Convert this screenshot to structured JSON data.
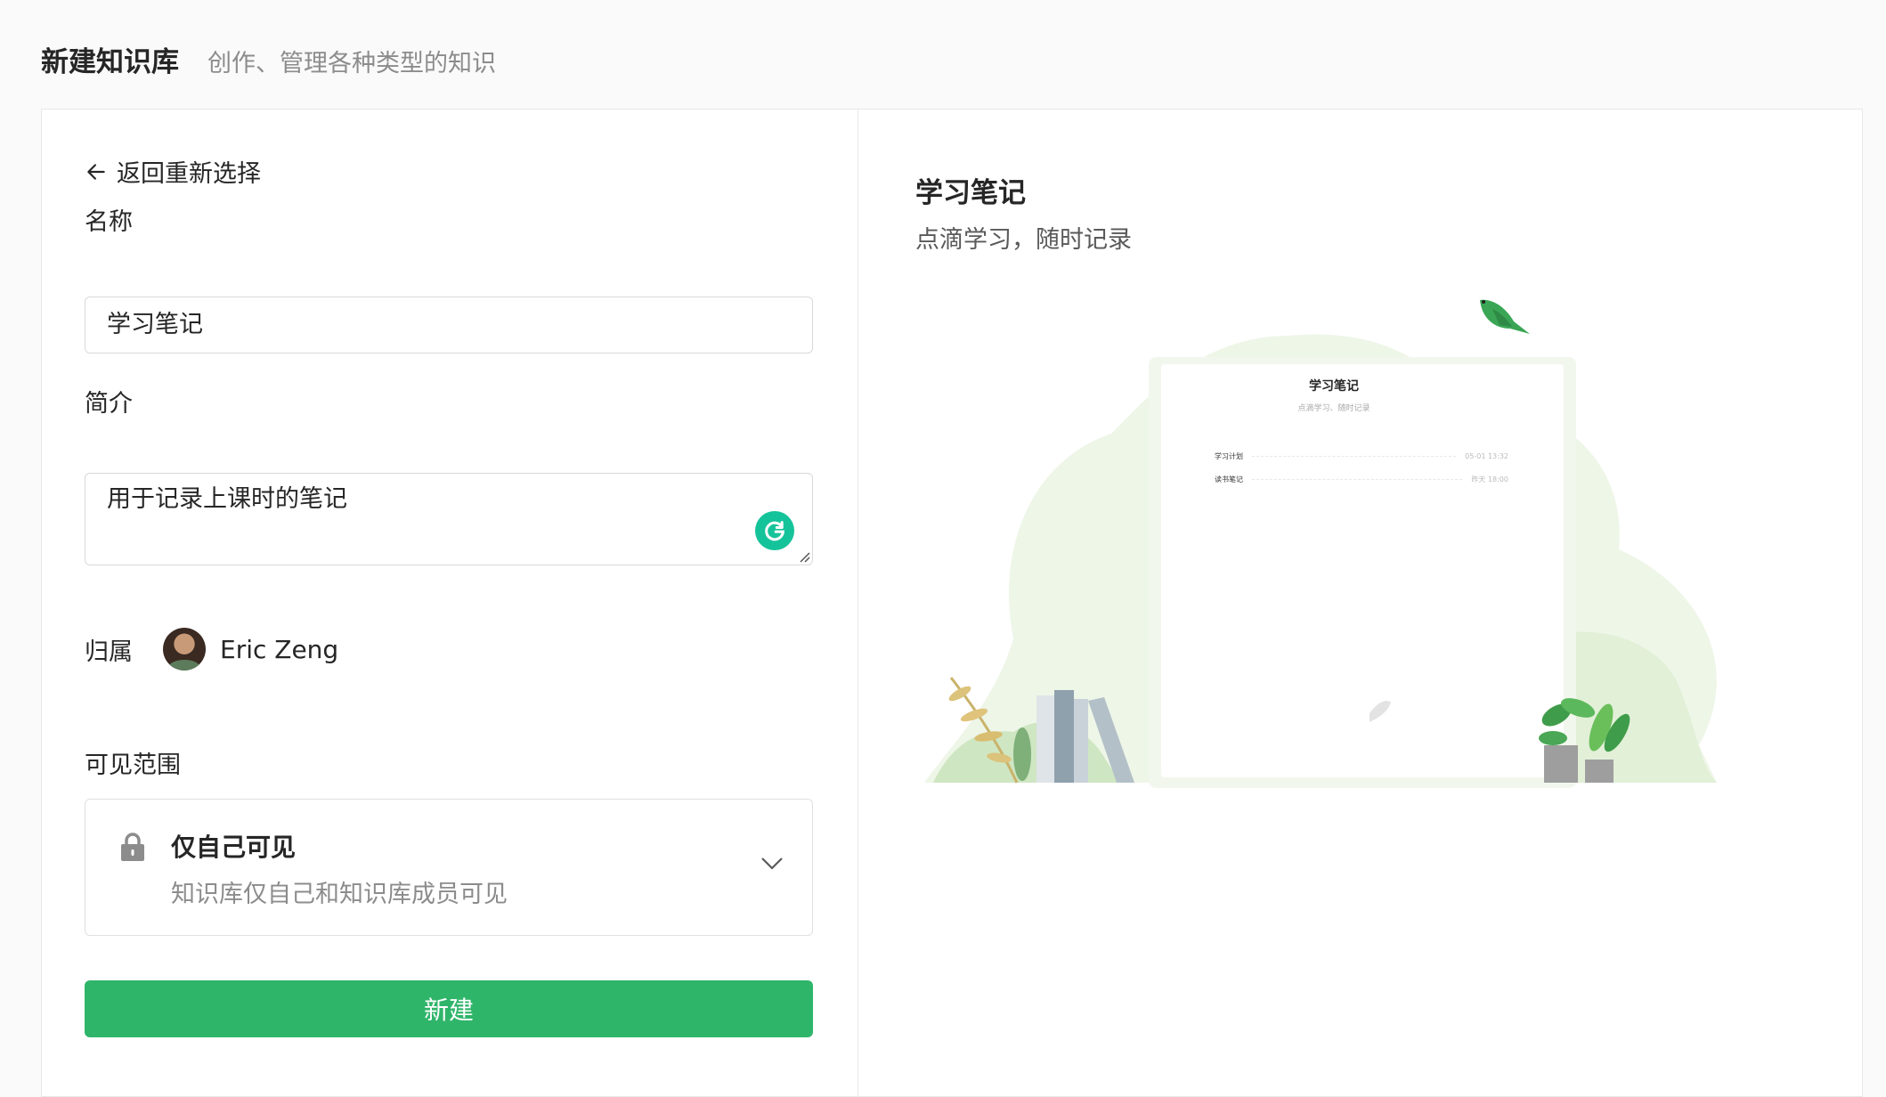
{
  "header": {
    "title": "新建知识库",
    "subtitle": "创作、管理各种类型的知识"
  },
  "form": {
    "back_label": "返回重新选择",
    "name_label": "名称",
    "name_value": "学习笔记",
    "desc_label": "简介",
    "desc_value": "用于记录上课时的笔记",
    "owner_label": "归属",
    "owner_name": "Eric Zeng",
    "visibility_label": "可见范围",
    "visibility_title": "仅自己可见",
    "visibility_desc": "知识库仅自己和知识库成员可见",
    "submit_label": "新建"
  },
  "preview": {
    "title": "学习笔记",
    "subtitle": "点滴学习，随时记录",
    "doc_title": "学习笔记",
    "doc_subtitle": "点滴学习、随时记录",
    "doc_rows": [
      {
        "label": "学习计划",
        "time": "05-01 13:32"
      },
      {
        "label": "读书笔记",
        "time": "昨天 18:00"
      }
    ]
  },
  "colors": {
    "primary": "#2fb56a",
    "grammarly": "#15c39a"
  },
  "icons": [
    "arrow-left-icon",
    "grammarly-icon",
    "lock-icon",
    "chevron-down-icon"
  ]
}
